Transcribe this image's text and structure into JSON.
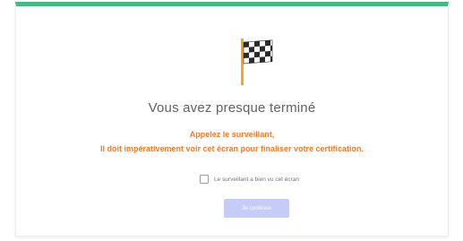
{
  "screen": {
    "title": "Vous avez presque terminé",
    "warning_line1": "Appelez le surveillant,",
    "warning_line2": "Il doit impérativement voir cet écran pour finaliser votre certification."
  },
  "confirmation": {
    "checkbox_label": "Le surveillant a bien vu cet écran",
    "checked": false
  },
  "continue_button": {
    "label": "Je continue",
    "enabled": false
  },
  "icon": "checkered-flag-icon",
  "colors": {
    "accent_bar": "#44b985",
    "warning_text": "#f07a2c",
    "title_text": "#616161",
    "button_disabled_bg": "#c5cdf6",
    "flag_pole": "#f5a623"
  }
}
